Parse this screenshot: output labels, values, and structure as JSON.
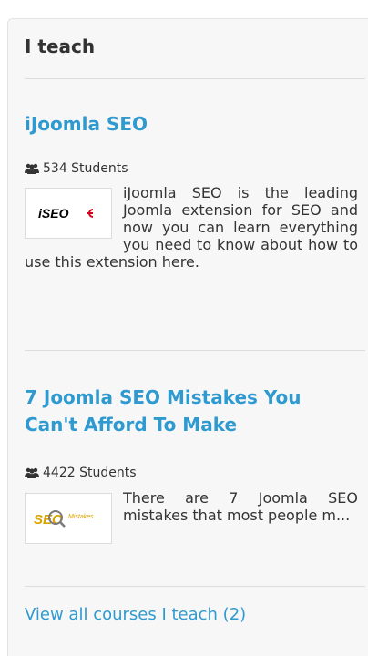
{
  "widget": {
    "heading": "I teach",
    "view_all_label": "View all courses I teach (2)"
  },
  "courses": [
    {
      "title": "iJoomla SEO",
      "students": "534 Students",
      "description": "iJoomla SEO is the leading Joomla extension for SEO and now you can learn everything you need to know about how to use this extension here.",
      "thumb_text": "iSEO"
    },
    {
      "title": "7 Joomla SEO Mistakes You Can't Afford To Make",
      "students": "4422 Students",
      "description": "There are 7 Joomla SEO mistakes that most people m...",
      "thumb_text": "SEO",
      "thumb_subtext": "Mistakes"
    }
  ],
  "icons": {
    "students": "users-icon",
    "thumb1": "iseo-logo",
    "thumb2": "seo-mistakes-logo"
  },
  "colors": {
    "link": "#2e9ad0",
    "panel_bg": "#f7f7f7",
    "divider": "#dddddd",
    "text": "#333333",
    "iseo_red": "#d0021b"
  }
}
